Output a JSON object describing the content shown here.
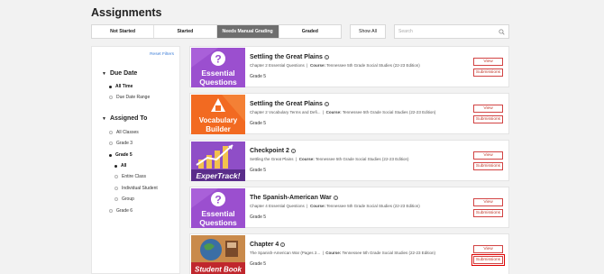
{
  "page": {
    "title": "Assignments"
  },
  "tabs": [
    "Not Started",
    "Started",
    "Needs Manual Grading",
    "Graded"
  ],
  "toolbar": {
    "show_all": "Show All",
    "search_placeholder": "Search"
  },
  "sidebar": {
    "reset": "Reset Filters",
    "due_date": {
      "heading": "Due Date",
      "all_time": "All Time",
      "due_date_range": "Due Date Range"
    },
    "assigned_to": {
      "heading": "Assigned To",
      "all_classes": "All Classes",
      "grade3": "Grade 3",
      "grade5": "Grade 5",
      "all": "All",
      "entire_class": "Entire Class",
      "individual_student": "Individual Student",
      "group": "Group",
      "grade6": "Grade 6"
    }
  },
  "cards": [
    {
      "title": "Settling the Great Plains",
      "subtitle": "Chapter 2 Essential Questions",
      "course_label": "Course:",
      "course": "Tennessee 5th Grade Social Studies (22-23 Edition)",
      "grade": "Grade 5",
      "thumb": {
        "line1": "Essential",
        "line2": "Questions"
      }
    },
    {
      "title": "Settling the Great Plains",
      "subtitle": "Chapter 2 Vocabulary Terms and Defi...",
      "course_label": "Course:",
      "course": "Tennessee 5th Grade Social Studies (22-23 Edition)",
      "grade": "Grade 5",
      "thumb": {
        "line1": "Vocabulary",
        "line2": "Builder"
      }
    },
    {
      "title": "Checkpoint 2",
      "subtitle": "Settling the Great Plains",
      "course_label": "Course:",
      "course": "Tennessee 5th Grade Social Studies (22-23 Edition)",
      "grade": "Grade 5",
      "thumb": {
        "line1": "ExperTrack!"
      }
    },
    {
      "title": "The Spanish-American War",
      "subtitle": "Chapter 4 Essential Questions",
      "course_label": "Course:",
      "course": "Tennessee 5th Grade Social Studies (22-23 Edition)",
      "grade": "Grade 5",
      "thumb": {
        "line1": "Essential",
        "line2": "Questions"
      }
    },
    {
      "title": "Chapter 4",
      "subtitle": "The Spanish-American War (Pages 2...",
      "course_label": "Course:",
      "course": "Tennessee 5th Grade Social Studies (22-23 Edition)",
      "grade": "Grade 5",
      "thumb": {
        "line1": "Student Book"
      }
    }
  ],
  "actions": {
    "view": "View",
    "submissions": "Submissions"
  },
  "info_glyph": "i",
  "colors": {
    "accent_red": "#c0392b",
    "active_tab": "#6e6e6e",
    "link_blue": "#3e7fd8",
    "purple": "#9b4fcf",
    "orange": "#f26a21"
  }
}
